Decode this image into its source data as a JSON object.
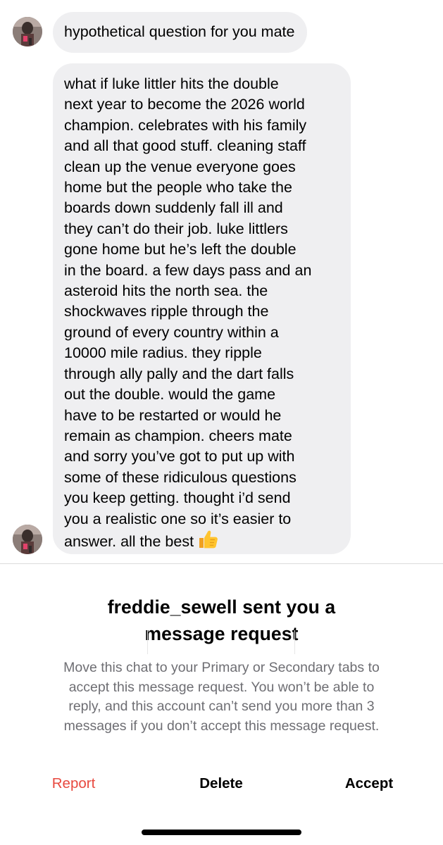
{
  "conversation": {
    "messages": [
      {
        "sender_avatar": "profile-photo",
        "lines": [
          "hypothetical question for you mate"
        ]
      },
      {
        "sender_avatar": "profile-photo",
        "lines": [
          "what if luke littler hits the double",
          "next year to become the 2026 world",
          "champion. celebrates with his family",
          "and all that good stuff. cleaning staff",
          "clean up the venue everyone goes",
          "home but the people who take the",
          "boards down suddenly fall ill and",
          "they can’t do their job. luke littlers",
          "gone home but he’s left the double",
          "in the board. a few days pass and an",
          "asteroid hits the north sea. the",
          "shockwaves ripple through the",
          "ground of every country within a",
          "10000 mile radius. they ripple",
          "through ally pally and the dart falls",
          "out the double. would the game",
          "have to be restarted or would he",
          "remain as champion. cheers mate",
          "and sorry you’ve got to put up with",
          "some of these ridiculous questions",
          "you keep getting. thought i’d send",
          "you a realistic one so it’s easier to",
          "answer. all the best"
        ],
        "trailing_emoji": "thumbs-up-icon"
      }
    ]
  },
  "request_panel": {
    "title_line_1": "freddie_sewell sent you a",
    "title_line_2": "message request",
    "body_lines": [
      "Move this chat to your Primary or Secondary tabs to",
      "accept this message request. You won’t be able to",
      "reply, and this account can’t send you more than 3",
      "messages if you don’t accept this message request."
    ],
    "actions": {
      "report": "Report",
      "delete": "Delete",
      "accept": "Accept"
    }
  },
  "colors": {
    "bubble_background": "#efeff1",
    "report_red": "#e8493f",
    "body_gray": "#6e6e73"
  }
}
